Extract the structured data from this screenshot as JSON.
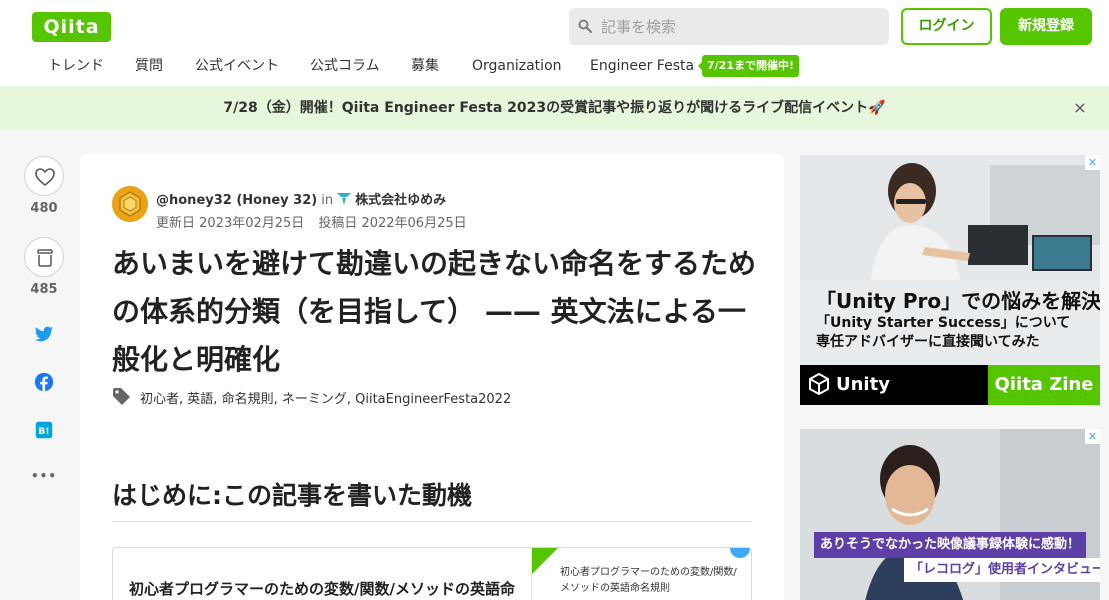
{
  "header": {
    "logo": "Qiita",
    "search_placeholder": "記事を検索",
    "login": "ログイン",
    "signup": "新規登録"
  },
  "nav": {
    "items": [
      "トレンド",
      "質問",
      "公式イベント",
      "公式コラム",
      "募集",
      "Organization",
      "Engineer Festa"
    ],
    "badge": "7/21まで開催中!"
  },
  "announcement": {
    "text": "7/28（金）開催！Qiita Engineer Festa 2023の受賞記事や振り返りが聞けるライブ配信イベント🚀",
    "close": "×"
  },
  "side": {
    "like_count": "480",
    "stock_count": "485",
    "more": "•••"
  },
  "article": {
    "author": "@honey32 (Honey 32)",
    "in": "in",
    "organization": "株式会社ゆめみ",
    "updated": "更新日 2023年02月25日",
    "posted": "投稿日 2022年06月25日",
    "title": "あいまいを避けて勘違いの起きない命名をするための体系的分類（を目指して） —— 英文法による一般化と明確化",
    "tags": [
      "初心者",
      "英語",
      "命名規則",
      "ネーミング",
      "QiitaEngineerFesta2022"
    ],
    "heading": "はじめに:この記事を書いた動機",
    "link_card": {
      "title": "初心者プログラマーのための変数/関数/メソッドの英語命名規則 - Qiita",
      "thumb_text": "初心者プログラマーのための変数/関数/メソッドの英語命名規則"
    }
  },
  "ads": {
    "ad1": {
      "line1": "「Unity Pro」での悩みを解決！",
      "line2": "「Unity Starter Success」について",
      "line3": "専任アドバイザーに直接聞いてみた",
      "brand": "Unity",
      "zine": "Qiita Zine"
    },
    "ad2": {
      "banner1": "ありそうでなかった映像議事録体験に感動！",
      "banner2": "「レコログ」使用者インタビュー"
    },
    "close": "✕"
  },
  "colors": {
    "brand_green": "#55c500",
    "announce_bg": "#e7f7dc",
    "twitter": "#1d9bf0",
    "facebook": "#1877f2",
    "hatena": "#00a4de"
  }
}
